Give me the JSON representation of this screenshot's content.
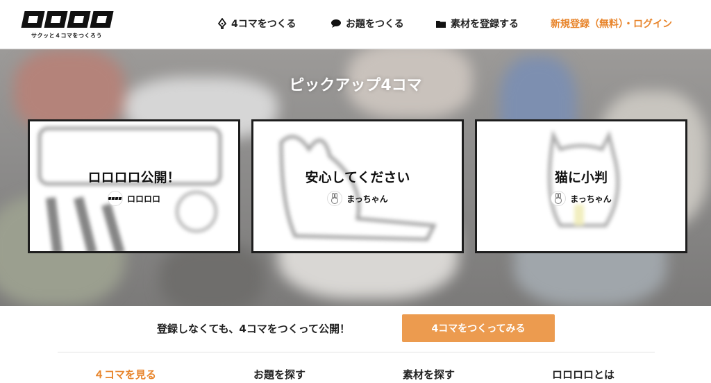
{
  "logo": {
    "tagline": "サクッと４コマをつくろう"
  },
  "nav": {
    "make_label": "4コマをつくる",
    "topic_label": "お題をつくる",
    "material_label": "素材を登録する",
    "login_label": "新規登録（無料）・ログイン"
  },
  "hero": {
    "title": "ピックアップ4コマ",
    "cards": [
      {
        "title": "ロロロロ公開！",
        "author": "ロロロロ"
      },
      {
        "title": "安心してください",
        "author": "まっちゃん"
      },
      {
        "title": "猫に小判",
        "author": "まっちゃん"
      }
    ]
  },
  "cta": {
    "text": "登録しなくても、4コマをつくって公開！",
    "button_label": "4コマをつくってみる"
  },
  "tabs": [
    {
      "label": "４コマを見る"
    },
    {
      "label": "お題を探す"
    },
    {
      "label": "素材を探す"
    },
    {
      "label": "ロロロロとは"
    }
  ],
  "colors": {
    "accent": "#e8852c",
    "button": "#ec9b4f"
  }
}
